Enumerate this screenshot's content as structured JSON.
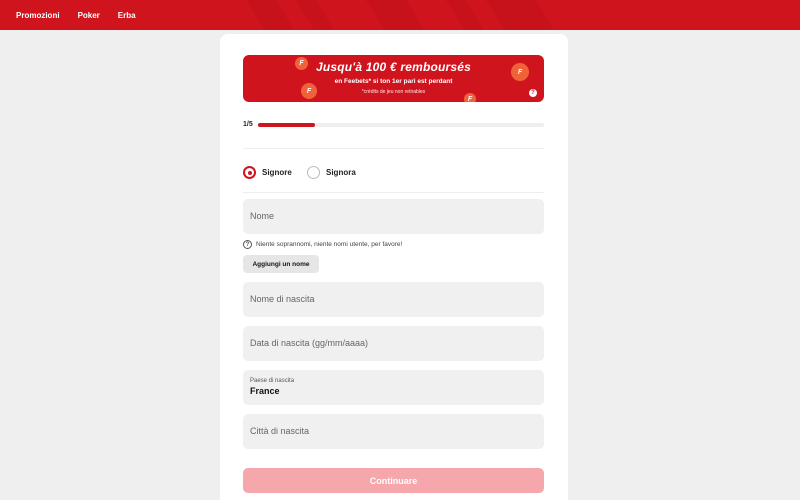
{
  "nav": {
    "items": [
      {
        "label": "Promozioni"
      },
      {
        "label": "Poker"
      },
      {
        "label": "Erba"
      }
    ]
  },
  "banner": {
    "headline": "Jusqu'à 100 € remboursés",
    "subline": "en Feebets* si ton 1er pari est perdant",
    "footnote": "*crédits de jeu non retirables",
    "coin_symbol": "F",
    "info_symbol": "?"
  },
  "progress": {
    "step_label": "1/5",
    "fraction": 0.2
  },
  "gender": {
    "options": [
      {
        "label": "Signore",
        "checked": true
      },
      {
        "label": "Signora",
        "checked": false
      }
    ]
  },
  "form": {
    "first_name": {
      "placeholder": "Nome"
    },
    "hint_icon": "?",
    "hint": "Niente soprannomi, niente nomi utente, per favore!",
    "add_name_label": "Aggiungi un nome",
    "birth_name": {
      "placeholder": "Nome di nascita"
    },
    "birth_date": {
      "placeholder": "Data di nascita (gg/mm/aaaa)"
    },
    "birth_country": {
      "label": "Paese di nascita",
      "value": "France"
    },
    "birth_city": {
      "placeholder": "Città di nascita"
    },
    "continue_label": "Continuare"
  },
  "colors": {
    "brand_red": "#d0141e",
    "button_disabled": "#f5a7ab",
    "background": "#efefef"
  }
}
